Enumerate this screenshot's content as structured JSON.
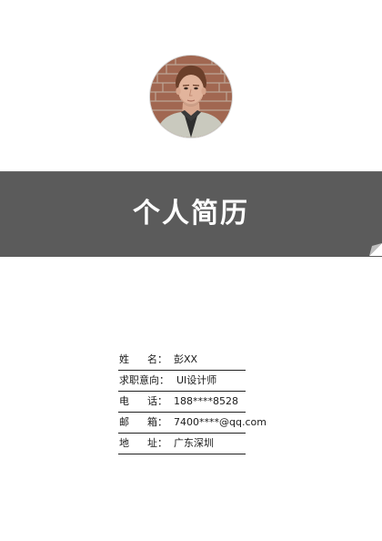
{
  "avatar": {
    "icon": "profile-photo"
  },
  "banner": {
    "title": "个人简历",
    "color": "#5b5b5b"
  },
  "info": [
    {
      "label_chars": [
        "姓",
        "名"
      ],
      "colon": "：",
      "value": "彭XX"
    },
    {
      "label_chars": [
        "求职意向"
      ],
      "colon": "：",
      "value": "UI设计师"
    },
    {
      "label_chars": [
        "电",
        "话"
      ],
      "colon": "：",
      "value": "188****8528"
    },
    {
      "label_chars": [
        "邮",
        "箱"
      ],
      "colon": "：",
      "value": "7400****@qq.com"
    },
    {
      "label_chars": [
        "地",
        "址"
      ],
      "colon": "：",
      "value": "广东深圳"
    }
  ]
}
